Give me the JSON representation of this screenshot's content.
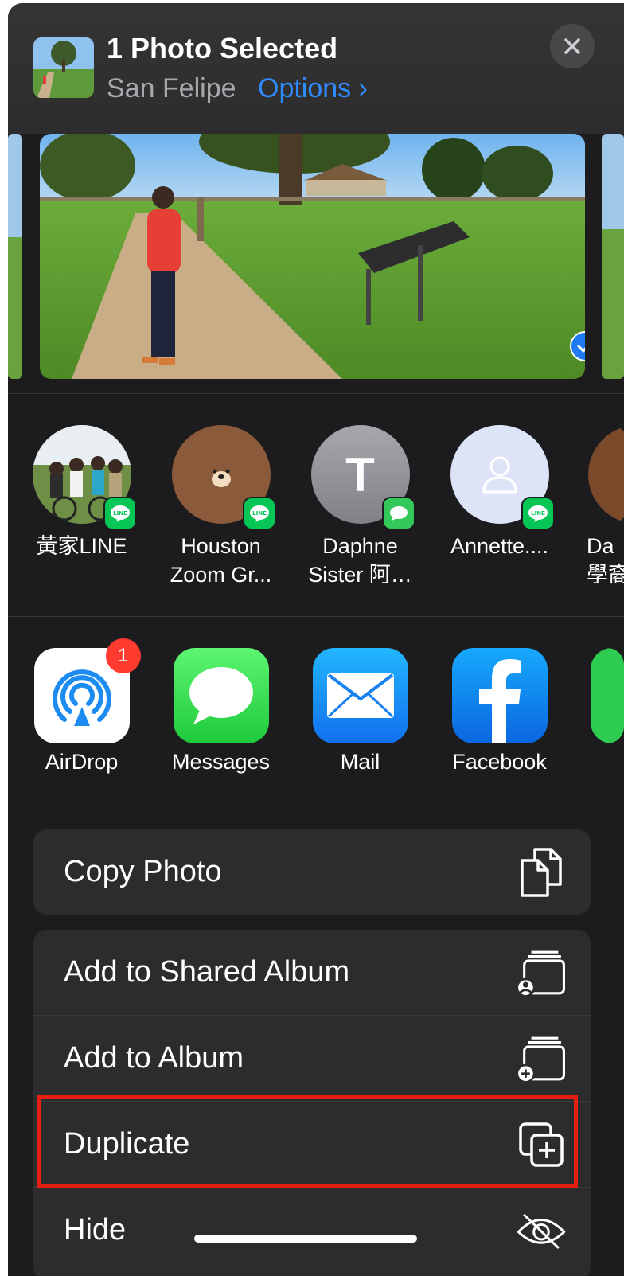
{
  "header": {
    "title": "1 Photo Selected",
    "location": "San Felipe",
    "options_label": "Options",
    "options_chevron": "›",
    "close_icon": "×"
  },
  "photo": {
    "selected": true
  },
  "people": [
    {
      "name_line1": "黃家LINE",
      "name_line2": "",
      "app": "line"
    },
    {
      "name_line1": "Houston",
      "name_line2": "Zoom Gr...",
      "app": "line"
    },
    {
      "name_line1": "Daphne",
      "name_line2": "Sister 阿…",
      "app": "messages",
      "initial": "T"
    },
    {
      "name_line1": "Annette....",
      "name_line2": "",
      "app": "line"
    },
    {
      "name_line1": "Da",
      "name_line2": "學裔",
      "app": "line"
    }
  ],
  "apps": [
    {
      "label": "AirDrop",
      "badge": "1"
    },
    {
      "label": "Messages"
    },
    {
      "label": "Mail"
    },
    {
      "label": "Facebook"
    }
  ],
  "actions": {
    "copy_photo": "Copy Photo",
    "add_shared_album": "Add to Shared Album",
    "add_album": "Add to Album",
    "duplicate": "Duplicate",
    "hide": "Hide"
  },
  "colors": {
    "accent": "#2f8cff",
    "highlight": "#e41e12",
    "sheet": "#1c1c1e",
    "line_green": "#06c755",
    "messages_green": "#34c759"
  }
}
